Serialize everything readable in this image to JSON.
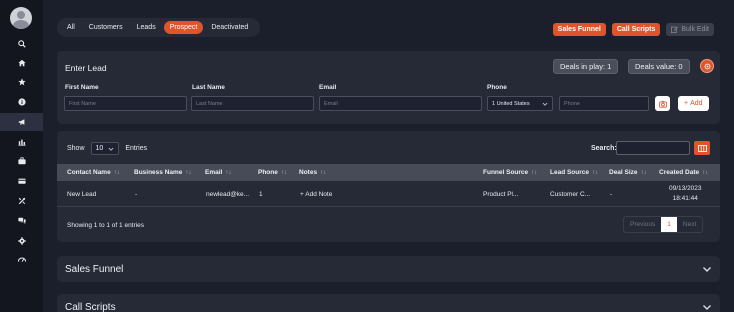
{
  "sidebar": {
    "items": [
      "search-icon",
      "home-icon",
      "star-icon",
      "info-icon",
      "megaphone-icon",
      "chart-icon",
      "briefcase-icon",
      "card-icon",
      "tools-icon",
      "chat-icon",
      "gear-icon",
      "speedometer-icon"
    ],
    "active": "megaphone-icon"
  },
  "tabs": [
    "All",
    "Customers",
    "Leads",
    "Prospect",
    "Deactivated"
  ],
  "active_tab": "Prospect",
  "top_buttons": {
    "sales_funnel": "Sales Funnel",
    "call_scripts": "Call Scripts",
    "bulk_edit": "Bulk Edit"
  },
  "lead": {
    "title": "Enter Lead",
    "deals_in_play": "Deals in play: 1",
    "deals_value": "Deals value: 0",
    "labels": {
      "first_name": "First Name",
      "last_name": "Last Name",
      "email": "Email",
      "phone": "Phone"
    },
    "placeholders": {
      "first_name": "First Name",
      "last_name": "Last Name",
      "email": "Email",
      "phone": "Phone"
    },
    "country": "1 United States",
    "add_label": "Add"
  },
  "table": {
    "show_label": "Show",
    "entries_value": "10",
    "entries_label": "Entries",
    "search_label": "Search:",
    "sort_glyph": "↑↓",
    "headers": [
      "Contact Name",
      "Business Name",
      "Email",
      "Phone",
      "Notes",
      "Funnel Source",
      "Lead Source",
      "Deal Size",
      "Created Date"
    ],
    "rows": [
      {
        "contact": "New Lead",
        "business": "-",
        "email": "newlead@ke...",
        "phone": "1",
        "notes": "+ Add Note",
        "funnel": "Product Pl...",
        "lead_source": "Customer C...",
        "deal_size": "-",
        "date": "09/13/2023",
        "time": "18:41:44"
      }
    ],
    "showing": "Showing 1 to 1 of 1 entries",
    "pager": {
      "prev": "Previous",
      "page": "1",
      "next": "Next"
    }
  },
  "accordions": {
    "sales_funnel": "Sales Funnel",
    "call_scripts": "Call Scripts"
  },
  "colors": {
    "accent": "#e0542c",
    "background": "#1b1e2b",
    "card": "#262a37"
  }
}
